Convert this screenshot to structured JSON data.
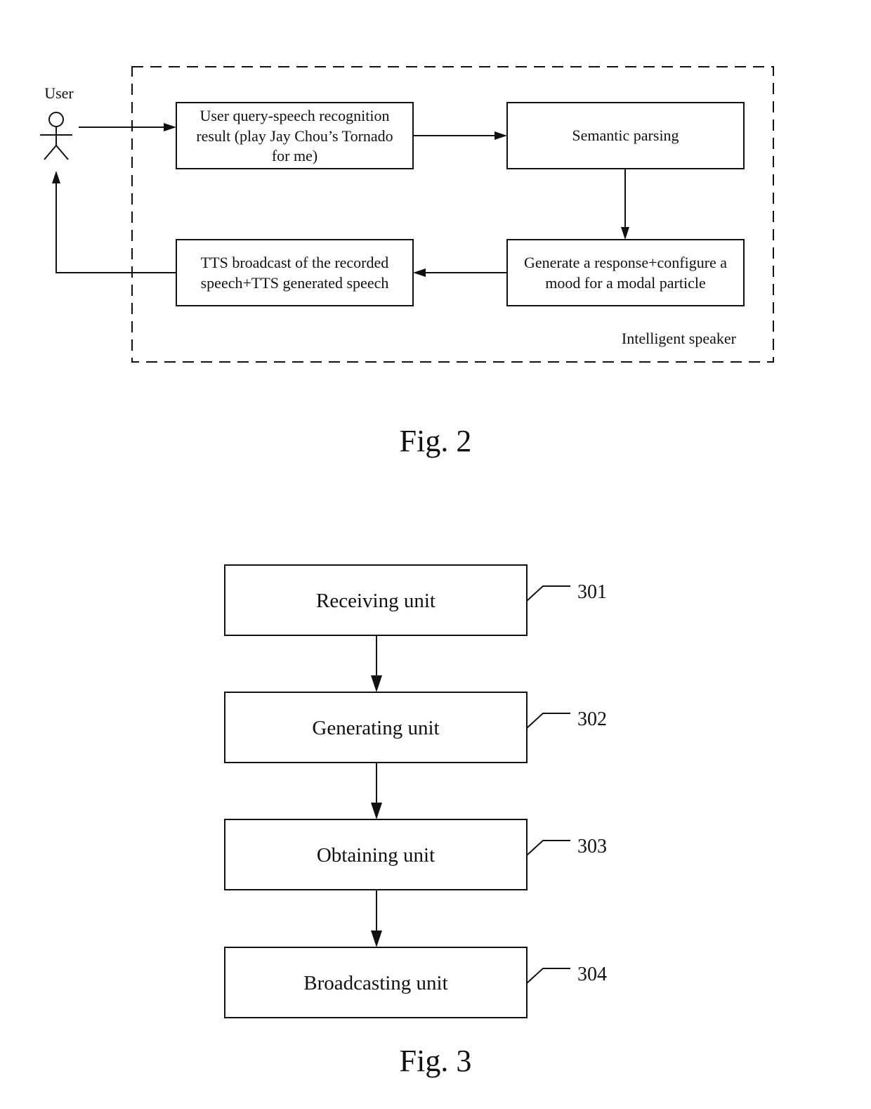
{
  "fig2": {
    "caption": "Fig. 2",
    "actor_label": "User",
    "container_label": "Intelligent speaker",
    "boxes": [
      {
        "id": "query",
        "lines": [
          "User query-speech recognition",
          "result (play Jay Chou’s Tornado",
          "for me)"
        ]
      },
      {
        "id": "semantic",
        "lines": [
          "Semantic parsing"
        ]
      },
      {
        "id": "generate",
        "lines": [
          "Generate a response+configure a",
          "mood for a modal particle"
        ]
      },
      {
        "id": "tts",
        "lines": [
          "TTS broadcast of the recorded",
          "speech+TTS generated speech"
        ]
      }
    ],
    "edges": [
      {
        "from": "user",
        "to": "query"
      },
      {
        "from": "query",
        "to": "semantic"
      },
      {
        "from": "semantic",
        "to": "generate"
      },
      {
        "from": "generate",
        "to": "tts"
      },
      {
        "from": "tts",
        "to": "user"
      }
    ]
  },
  "fig3": {
    "caption": "Fig. 3",
    "units": [
      {
        "label": "Receiving unit",
        "ref": "301"
      },
      {
        "label": "Generating unit",
        "ref": "302"
      },
      {
        "label": "Obtaining unit",
        "ref": "303"
      },
      {
        "label": "Broadcasting unit",
        "ref": "304"
      }
    ],
    "edges": [
      {
        "from": "301",
        "to": "302"
      },
      {
        "from": "302",
        "to": "303"
      },
      {
        "from": "303",
        "to": "304"
      }
    ]
  }
}
